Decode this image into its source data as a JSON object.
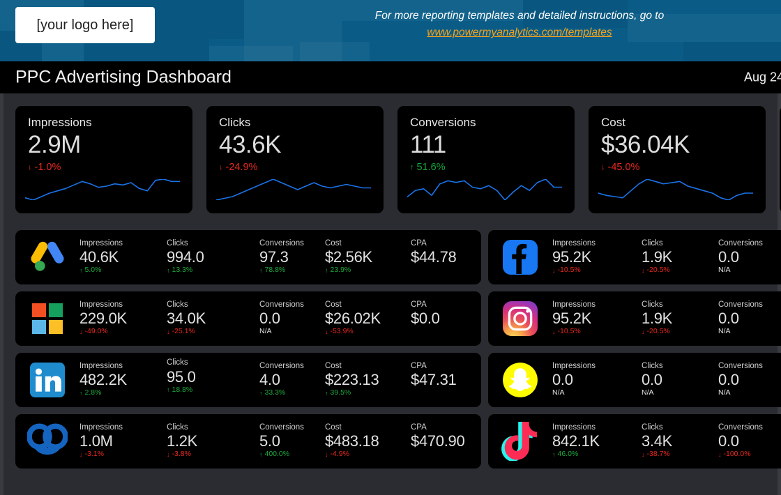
{
  "banner": {
    "logo_placeholder": "[your logo here]",
    "promo_text": "For more reporting templates and detailed instructions, go to",
    "promo_link": "www.powermyanalytics.com/templates",
    "bg_color": "#0a5c87",
    "link_color": "#f5a31b"
  },
  "titlebar": {
    "title": "PPC Advertising Dashboard",
    "date_range": "Aug 24",
    "bg_color": "#000000"
  },
  "colors": {
    "page_bg": "#2b2c31",
    "card_bg": "#000000",
    "up": "#1faa3c",
    "down": "#e8271f",
    "spark": "#1a73e8"
  },
  "kpi_cards": [
    {
      "name": "impressions",
      "label": "Impressions",
      "value": "2.9M",
      "delta": "-1.0%",
      "direction": "down",
      "arrow": "↓",
      "spark": [
        8,
        6,
        9,
        12,
        14,
        16,
        19,
        22,
        20,
        17,
        18,
        20,
        19,
        21,
        16,
        14,
        23,
        24,
        22,
        22
      ]
    },
    {
      "name": "clicks",
      "label": "Clicks",
      "value": "43.6K",
      "delta": "-24.9%",
      "direction": "down",
      "arrow": "↓",
      "spark": [
        12,
        13,
        14,
        16,
        18,
        20,
        22,
        24,
        22,
        20,
        18,
        20,
        22,
        20,
        19,
        20,
        21,
        20,
        19,
        19
      ]
    },
    {
      "name": "conversions",
      "label": "Conversions",
      "value": "111",
      "delta": "51.6%",
      "direction": "up",
      "arrow": "↑",
      "spark": [
        6,
        14,
        16,
        8,
        22,
        26,
        24,
        26,
        18,
        16,
        20,
        14,
        2,
        12,
        20,
        14,
        24,
        28,
        18,
        18
      ]
    },
    {
      "name": "cost",
      "label": "Cost",
      "value": "$36.04K",
      "delta": "-45.0%",
      "direction": "down",
      "arrow": "↓",
      "spark": [
        10,
        8,
        7,
        6,
        12,
        18,
        22,
        20,
        18,
        19,
        20,
        16,
        14,
        12,
        10,
        6,
        4,
        8,
        10,
        10
      ]
    },
    {
      "name": "partial",
      "label": "",
      "value": "",
      "delta": "",
      "direction": "",
      "arrow": "",
      "spark": [
        16,
        15,
        14,
        14,
        14,
        14,
        14,
        14,
        14,
        14,
        14,
        14,
        14,
        14,
        14,
        14,
        14,
        14,
        14,
        14
      ]
    }
  ],
  "channels_left": [
    {
      "icon": "google-ads-icon",
      "name": "google-ads",
      "metrics": [
        {
          "label": "Impressions",
          "value": "40.6K",
          "delta": "5.0%",
          "direction": "up",
          "arrow": "↑"
        },
        {
          "label": "Clicks",
          "value": "994.0",
          "delta": "13.3%",
          "direction": "up",
          "arrow": "↑"
        },
        {
          "label": "Conversions",
          "value": "97.3",
          "delta": "78.8%",
          "direction": "up",
          "arrow": "↑"
        },
        {
          "label": "Cost",
          "value": "$2.56K",
          "delta": "23.9%",
          "direction": "up",
          "arrow": "↑"
        },
        {
          "label": "CPA",
          "value": "$44.78",
          "delta": "",
          "direction": "none",
          "arrow": ""
        }
      ]
    },
    {
      "icon": "microsoft-ads-icon",
      "name": "microsoft-ads",
      "metrics": [
        {
          "label": "Impressions",
          "value": "229.0K",
          "delta": "-49.0%",
          "direction": "down",
          "arrow": "↓"
        },
        {
          "label": "Clicks",
          "value": "34.0K",
          "delta": "-25.1%",
          "direction": "down",
          "arrow": "↓"
        },
        {
          "label": "Conversions",
          "value": "0.0",
          "delta": "N/A",
          "direction": "na",
          "arrow": ""
        },
        {
          "label": "Cost",
          "value": "$26.02K",
          "delta": "-53.9%",
          "direction": "down",
          "arrow": "↓"
        },
        {
          "label": "CPA",
          "value": "$0.0",
          "delta": "",
          "direction": "none",
          "arrow": ""
        }
      ]
    },
    {
      "icon": "linkedin-icon",
      "name": "linkedin-ads",
      "metrics": [
        {
          "label": "Impressions",
          "value": "482.2K",
          "delta": "2.8%",
          "direction": "up",
          "arrow": "↑"
        },
        {
          "label": "Clicks",
          "value": "95.0",
          "delta": "18.8%",
          "direction": "up",
          "arrow": "↑",
          "raised": true
        },
        {
          "label": "Conversions",
          "value": "4.0",
          "delta": "33.3%",
          "direction": "up",
          "arrow": "↑"
        },
        {
          "label": "Cost",
          "value": "$223.13",
          "delta": "39.5%",
          "direction": "up",
          "arrow": "↑"
        },
        {
          "label": "CPA",
          "value": "$47.31",
          "delta": "",
          "direction": "none",
          "arrow": ""
        }
      ]
    },
    {
      "icon": "quora-icon",
      "name": "quora-ads",
      "metrics": [
        {
          "label": "Impressions",
          "value": "1.0M",
          "delta": "-3.1%",
          "direction": "down",
          "arrow": "↓"
        },
        {
          "label": "Clicks",
          "value": "1.2K",
          "delta": "-3.8%",
          "direction": "down",
          "arrow": "↓"
        },
        {
          "label": "Conversions",
          "value": "5.0",
          "delta": "400.0%",
          "direction": "up",
          "arrow": "↑"
        },
        {
          "label": "Cost",
          "value": "$483.18",
          "delta": "-4.9%",
          "direction": "down",
          "arrow": "↓"
        },
        {
          "label": "CPA",
          "value": "$470.90",
          "delta": "",
          "direction": "none",
          "arrow": ""
        }
      ]
    }
  ],
  "channels_right": [
    {
      "icon": "facebook-icon",
      "name": "facebook-ads",
      "metrics": [
        {
          "label": "Impressions",
          "value": "95.2K",
          "delta": "-10.5%",
          "direction": "down",
          "arrow": "↓"
        },
        {
          "label": "Clicks",
          "value": "1.9K",
          "delta": "-20.5%",
          "direction": "down",
          "arrow": "↓"
        },
        {
          "label": "Conversions",
          "value": "0.0",
          "delta": "N/A",
          "direction": "na",
          "arrow": ""
        }
      ]
    },
    {
      "icon": "instagram-icon",
      "name": "instagram-ads",
      "metrics": [
        {
          "label": "Impressions",
          "value": "95.2K",
          "delta": "-10.5%",
          "direction": "down",
          "arrow": "↓"
        },
        {
          "label": "Clicks",
          "value": "1.9K",
          "delta": "-20.5%",
          "direction": "down",
          "arrow": "↓"
        },
        {
          "label": "Conversions",
          "value": "0.0",
          "delta": "N/A",
          "direction": "na",
          "arrow": ""
        }
      ]
    },
    {
      "icon": "snapchat-icon",
      "name": "snapchat-ads",
      "metrics": [
        {
          "label": "Impressions",
          "value": "0.0",
          "delta": "N/A",
          "direction": "na",
          "arrow": ""
        },
        {
          "label": "Clicks",
          "value": "0.0",
          "delta": "N/A",
          "direction": "na",
          "arrow": ""
        },
        {
          "label": "Conversions",
          "value": "0.0",
          "delta": "N/A",
          "direction": "na",
          "arrow": ""
        }
      ]
    },
    {
      "icon": "tiktok-icon",
      "name": "tiktok-ads",
      "metrics": [
        {
          "label": "Impressions",
          "value": "842.1K",
          "delta": "46.0%",
          "direction": "up",
          "arrow": "↑"
        },
        {
          "label": "Clicks",
          "value": "3.4K",
          "delta": "-38.7%",
          "direction": "down",
          "arrow": "↓"
        },
        {
          "label": "Conversions",
          "value": "0.0",
          "delta": "-100.0%",
          "direction": "down",
          "arrow": "↓"
        }
      ]
    }
  ]
}
